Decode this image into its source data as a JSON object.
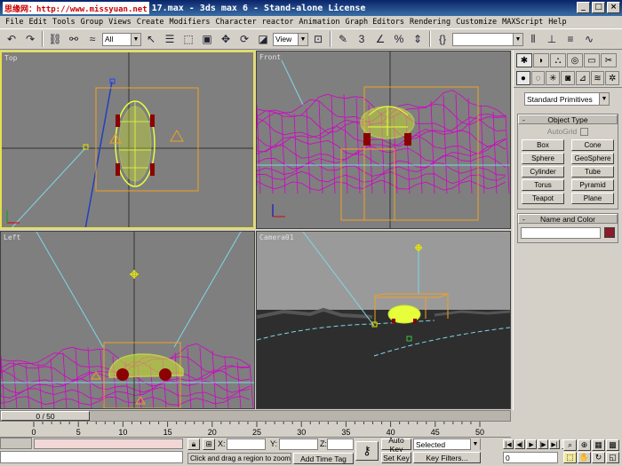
{
  "window": {
    "title": "17.max - 3ds max 6 - Stand-alone License",
    "watermark": "思缘网：http://www.missyuan.net"
  },
  "menu": [
    "File",
    "Edit",
    "Tools",
    "Group",
    "Views",
    "Create",
    "Modifiers",
    "Character",
    "reactor",
    "Animation",
    "Graph Editors",
    "Rendering",
    "Customize",
    "MAXScript",
    "Help"
  ],
  "toolbar": {
    "selection_filter": "All",
    "ref_coord": "View"
  },
  "viewports": {
    "top": "Top",
    "front": "Front",
    "left": "Left",
    "camera": "Camera01"
  },
  "command_panel": {
    "category": "Standard Primitives",
    "object_type_title": "Object Type",
    "autogrid_label": "AutoGrid",
    "buttons": [
      "Box",
      "Cone",
      "Sphere",
      "GeoSphere",
      "Cylinder",
      "Tube",
      "Torus",
      "Pyramid",
      "Teapot",
      "Plane"
    ],
    "name_color_title": "Name and Color",
    "name_color_value": "#8b1a2a"
  },
  "timeline": {
    "frame_display": "0 / 50",
    "ticks": [
      "0",
      "5",
      "10",
      "15",
      "20",
      "25",
      "30",
      "35",
      "40",
      "45",
      "50"
    ]
  },
  "status": {
    "x_label": "X:",
    "y_label": "Y:",
    "z_label": "Z:",
    "prompt": "Click and drag a region to zoom into",
    "add_time_tag": "Add Time Tag",
    "auto_key": "Auto Key",
    "set_key": "Set Key",
    "key_selected": "Selected",
    "key_filters": "Key Filters...",
    "current_frame": "0"
  },
  "colors": {
    "wire_magenta": "#d400c8",
    "car_yellow": "#e6ff3a",
    "viewport_grey": "#7f7f7f",
    "active_border": "#e8e04a",
    "bbox_orange": "#f2a020",
    "camera_cyan": "#7fd7e8"
  }
}
